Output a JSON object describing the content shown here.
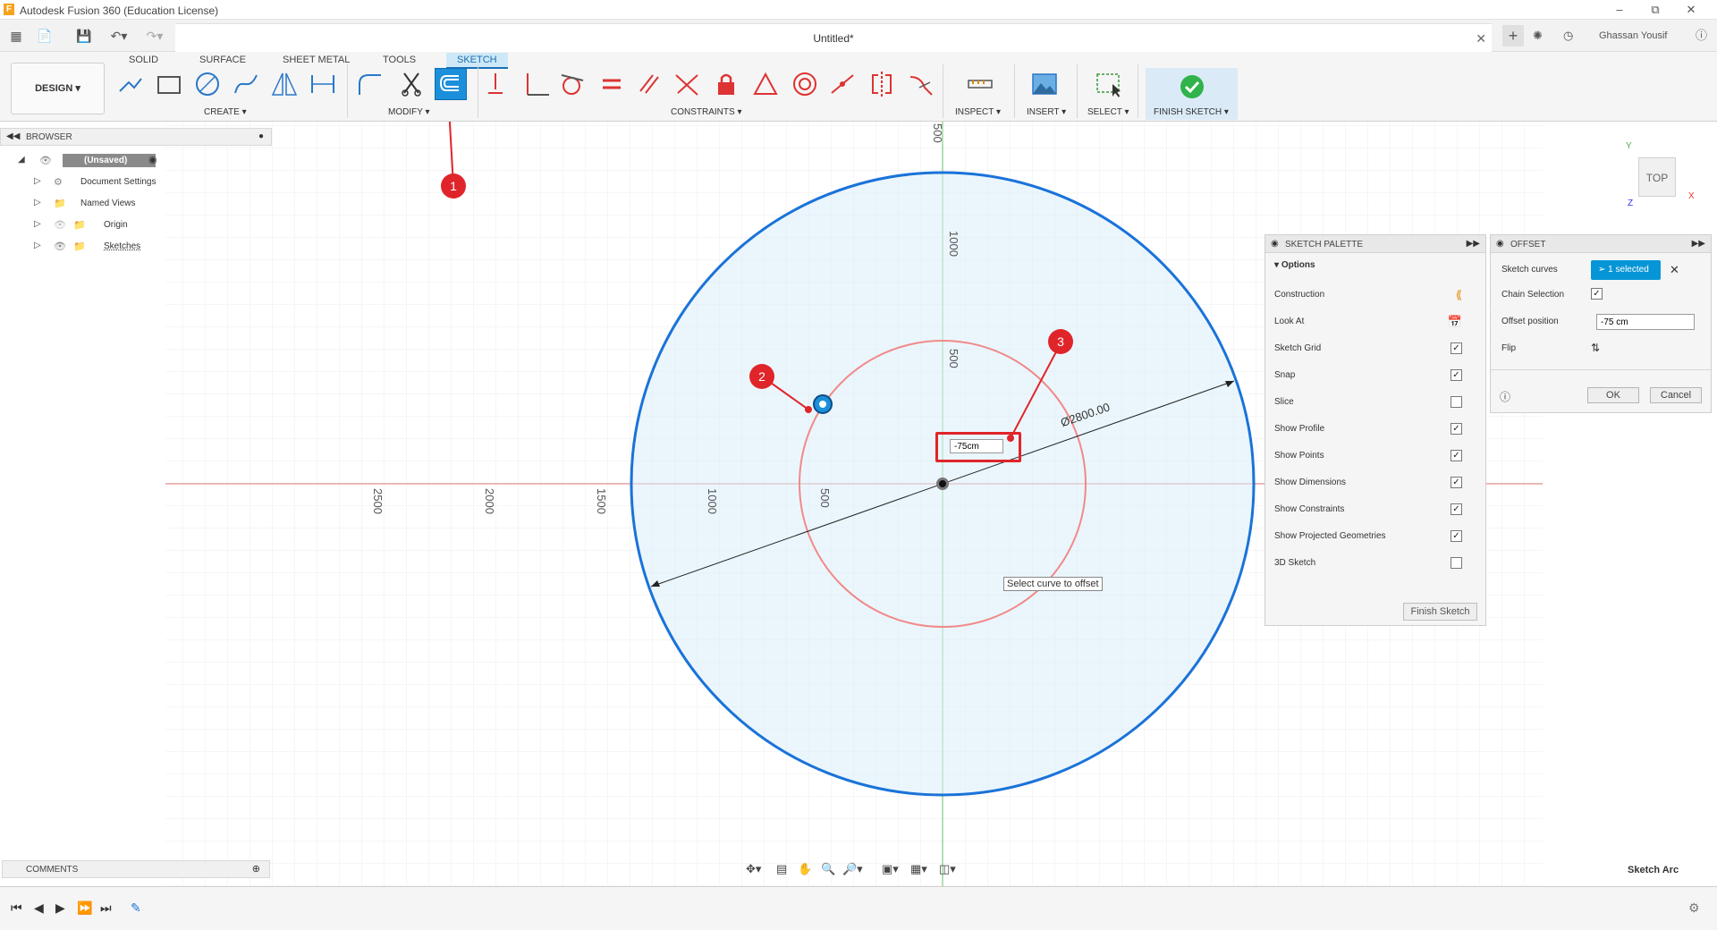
{
  "window": {
    "title": "Autodesk Fusion 360 (Education License)"
  },
  "document": {
    "title": "Untitled*"
  },
  "user": {
    "name": "Ghassan Yousif"
  },
  "ribbon": {
    "tabs": [
      "SOLID",
      "SURFACE",
      "SHEET METAL",
      "TOOLS",
      "SKETCH"
    ],
    "active_tab": "SKETCH",
    "workspace": "DESIGN",
    "groups": {
      "create": "CREATE",
      "modify": "MODIFY",
      "constraints": "CONSTRAINTS",
      "inspect": "INSPECT",
      "insert": "INSERT",
      "select": "SELECT",
      "finish": "FINISH SKETCH"
    }
  },
  "browser": {
    "title": "BROWSER",
    "root": "(Unsaved)",
    "items": [
      "Document Settings",
      "Named Views",
      "Origin",
      "Sketches"
    ]
  },
  "comments": {
    "title": "COMMENTS"
  },
  "canvas": {
    "axis_labels_vertical": [
      "500",
      "1000",
      "500"
    ],
    "axis_labels_horizontal": [
      "2500",
      "2000",
      "1500",
      "1000",
      "500"
    ],
    "diameter_label": "Ø2800.00",
    "tooltip": "Select curve to offset",
    "offset_value": "-75cm",
    "callouts": [
      "1",
      "2",
      "3"
    ]
  },
  "sketch_palette": {
    "title": "SKETCH PALETTE",
    "section": "Options",
    "options": [
      {
        "label": "Construction",
        "type": "icon"
      },
      {
        "label": "Look At",
        "type": "icon"
      },
      {
        "label": "Sketch Grid",
        "checked": true
      },
      {
        "label": "Snap",
        "checked": true
      },
      {
        "label": "Slice",
        "checked": false
      },
      {
        "label": "Show Profile",
        "checked": true
      },
      {
        "label": "Show Points",
        "checked": true
      },
      {
        "label": "Show Dimensions",
        "checked": true
      },
      {
        "label": "Show Constraints",
        "checked": true
      },
      {
        "label": "Show Projected Geometries",
        "checked": true
      },
      {
        "label": "3D Sketch",
        "checked": false
      }
    ],
    "finish_button": "Finish Sketch"
  },
  "offset_dialog": {
    "title": "OFFSET",
    "sketch_curves_label": "Sketch curves",
    "selection": "1 selected",
    "chain_selection_label": "Chain Selection",
    "chain_selection": true,
    "offset_position_label": "Offset position",
    "offset_position": "-75 cm",
    "flip_label": "Flip",
    "ok": "OK",
    "cancel": "Cancel"
  },
  "viewcube": {
    "face": "TOP",
    "x": "X",
    "y": "Y",
    "z": "Z"
  },
  "status": {
    "text": "Sketch Arc"
  },
  "colors": {
    "accent": "#0696d7",
    "callout": "#e0252a",
    "circle_outer": "#1a73d9",
    "circle_inner": "#f08a8a"
  }
}
